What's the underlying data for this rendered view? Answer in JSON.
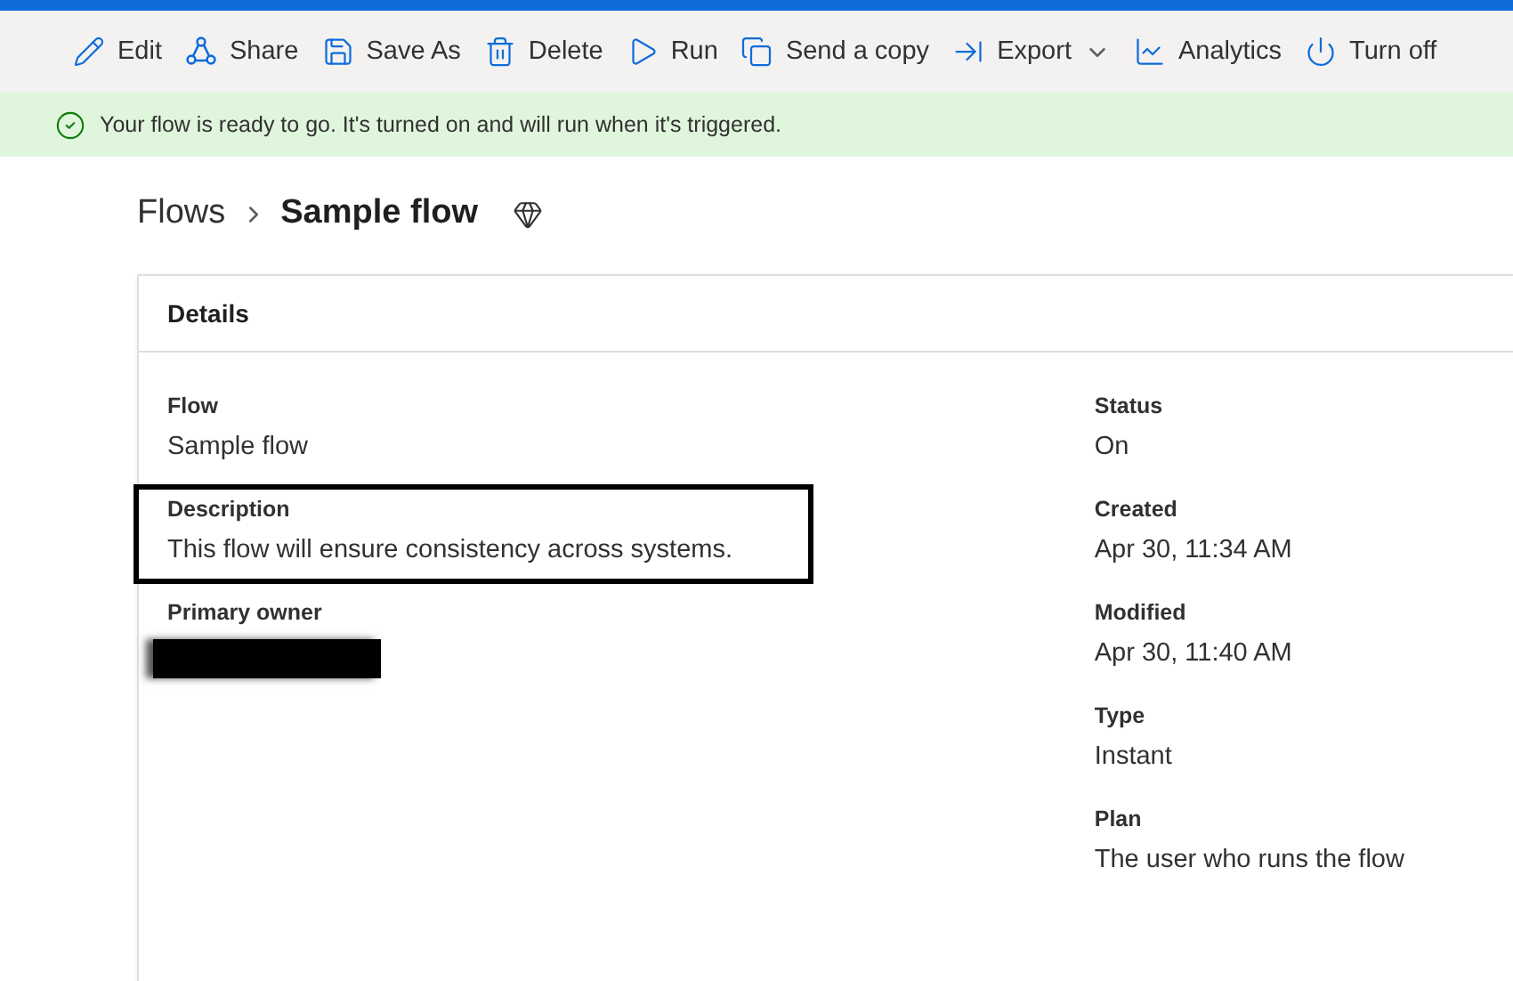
{
  "toolbar": [
    {
      "label": "Edit",
      "kind": "edit"
    },
    {
      "label": "Share",
      "kind": "share"
    },
    {
      "label": "Save As",
      "kind": "save"
    },
    {
      "label": "Delete",
      "kind": "delete"
    },
    {
      "label": "Run",
      "kind": "run"
    },
    {
      "label": "Send a copy",
      "kind": "copy"
    },
    {
      "label": "Export",
      "kind": "export",
      "dropdown": true
    },
    {
      "label": "Analytics",
      "kind": "analytics"
    },
    {
      "label": "Turn off",
      "kind": "power"
    }
  ],
  "banner": {
    "message": "Your flow is ready to go. It's turned on and will run when it's triggered."
  },
  "breadcrumb": {
    "parent": "Flows",
    "current": "Sample flow"
  },
  "details": {
    "title": "Details",
    "left": [
      {
        "label": "Flow",
        "value": "Sample flow",
        "highlighted": false
      },
      {
        "label": "Description",
        "value": "This flow will ensure consistency across systems.",
        "highlighted": true
      },
      {
        "label": "Primary owner",
        "redacted": true,
        "highlighted": false
      }
    ],
    "right": [
      {
        "label": "Status",
        "value": "On"
      },
      {
        "label": "Created",
        "value": "Apr 30, 11:34 AM"
      },
      {
        "label": "Modified",
        "value": "Apr 30, 11:40 AM"
      },
      {
        "label": "Type",
        "value": "Instant"
      },
      {
        "label": "Plan",
        "value": "The user who runs the flow"
      }
    ]
  }
}
